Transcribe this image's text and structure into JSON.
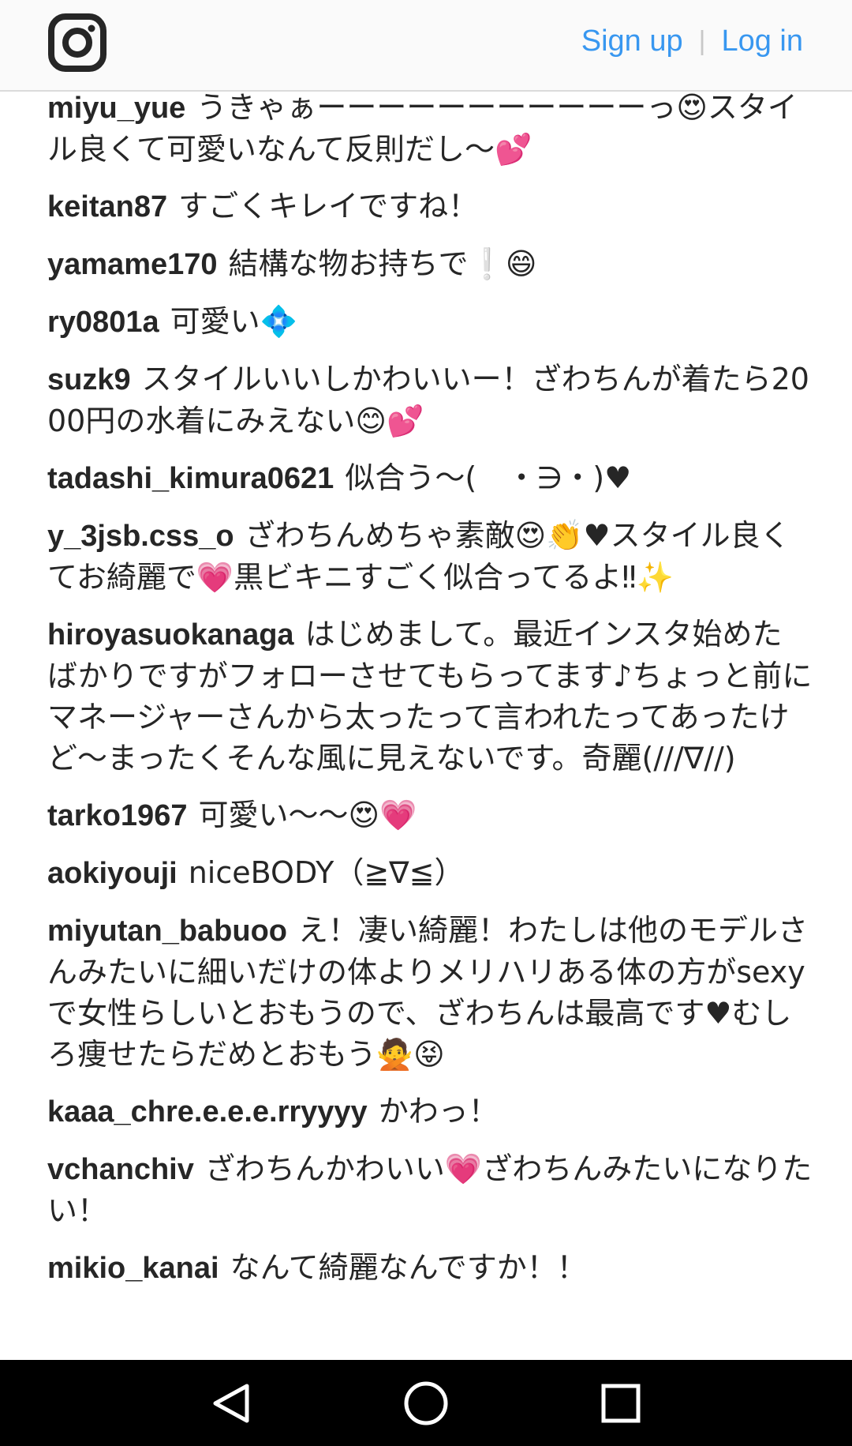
{
  "header": {
    "logo_icon": "instagram-camera-icon",
    "signup_label": "Sign up",
    "separator": "|",
    "login_label": "Log in",
    "link_color": "#3897f0"
  },
  "comments": [
    {
      "user": "miyu_yue",
      "text": "うきゃぁーーーーーーーーーーーっ😍スタイル良くて可愛いなんて反則だし〜💕"
    },
    {
      "user": "keitan87",
      "text": "すごくキレイですね！"
    },
    {
      "user": "yamame170",
      "text": "結構な物お持ちで❕😄"
    },
    {
      "user": "ry0801a",
      "text": "可愛い💠"
    },
    {
      "user": "suzk9",
      "text": "スタイルいいしかわいいー！ざわちんが着たら2000円の水着にみえない😊💕"
    },
    {
      "user": "tadashi_kimura0621",
      "text": "似合う〜(　・∋・)♥"
    },
    {
      "user": "y_3jsb.css_o",
      "text": "ざわちんめちゃ素敵😍👏♥スタイル良くてお綺麗で💗黒ビキニすごく似合ってるよ‼✨"
    },
    {
      "user": "hiroyasuokanaga",
      "text": "はじめまして。最近インスタ始めたばかりですがフォローさせてもらってます♪ちょっと前にマネージャーさんから太ったって言われたってあったけど〜まったくそんな風に見えないです。奇麗(///∇//)"
    },
    {
      "user": "tarko1967",
      "text": "可愛い〜〜😍💗"
    },
    {
      "user": "aokiyouji",
      "text": "niceBODY（≧∇≦）"
    },
    {
      "user": "miyutan_babuoo",
      "text": "え！凄い綺麗！わたしは他のモデルさんみたいに細いだけの体よりメリハリある体の方がsexyで女性らしいとおもうので、ざわちんは最高です♥むしろ痩せたらだめとおもう🙅😝"
    },
    {
      "user": "kaaa_chre.e.e.e.rryyyy",
      "text": "かわっ！"
    },
    {
      "user": "vchanchiv",
      "text": "ざわちんかわいい💗ざわちんみたいになりたい！"
    },
    {
      "user": "mikio_kanai",
      "text": "なんて綺麗なんですか！！"
    }
  ],
  "navbar": {
    "back_icon": "back-triangle-icon",
    "home_icon": "home-circle-icon",
    "recents_icon": "recents-square-icon"
  }
}
